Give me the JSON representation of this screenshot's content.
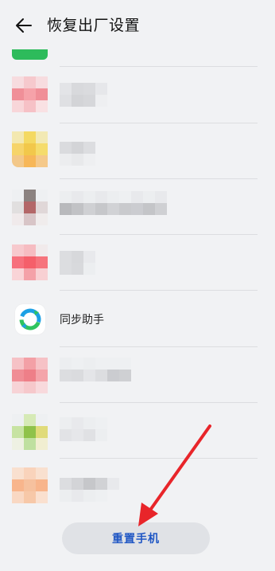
{
  "header": {
    "title": "恢复出厂设置",
    "back_icon": "back-arrow-icon"
  },
  "apps": [
    {
      "name": "",
      "icon": "app-icon-green",
      "blurred": true
    },
    {
      "name": "",
      "icon": "app-icon-pink",
      "blurred": true
    },
    {
      "name": "",
      "icon": "app-icon-yellow",
      "blurred": true
    },
    {
      "name": "",
      "icon": "app-icon-grey-red",
      "blurred": true
    },
    {
      "name": "",
      "icon": "app-icon-red",
      "blurred": true
    },
    {
      "name": "同步助手",
      "icon": "sync-assistant-icon",
      "blurred": false
    },
    {
      "name": "",
      "icon": "app-icon-pink-red",
      "blurred": true
    },
    {
      "name": "",
      "icon": "app-icon-green-yellow",
      "blurred": true
    },
    {
      "name": "",
      "icon": "app-icon-orange",
      "blurred": true
    }
  ],
  "reset_button": {
    "label": "重置手机"
  },
  "colors": {
    "accent": "#1f56c4",
    "arrow": "#e8252a",
    "background": "#f1f2f4"
  }
}
